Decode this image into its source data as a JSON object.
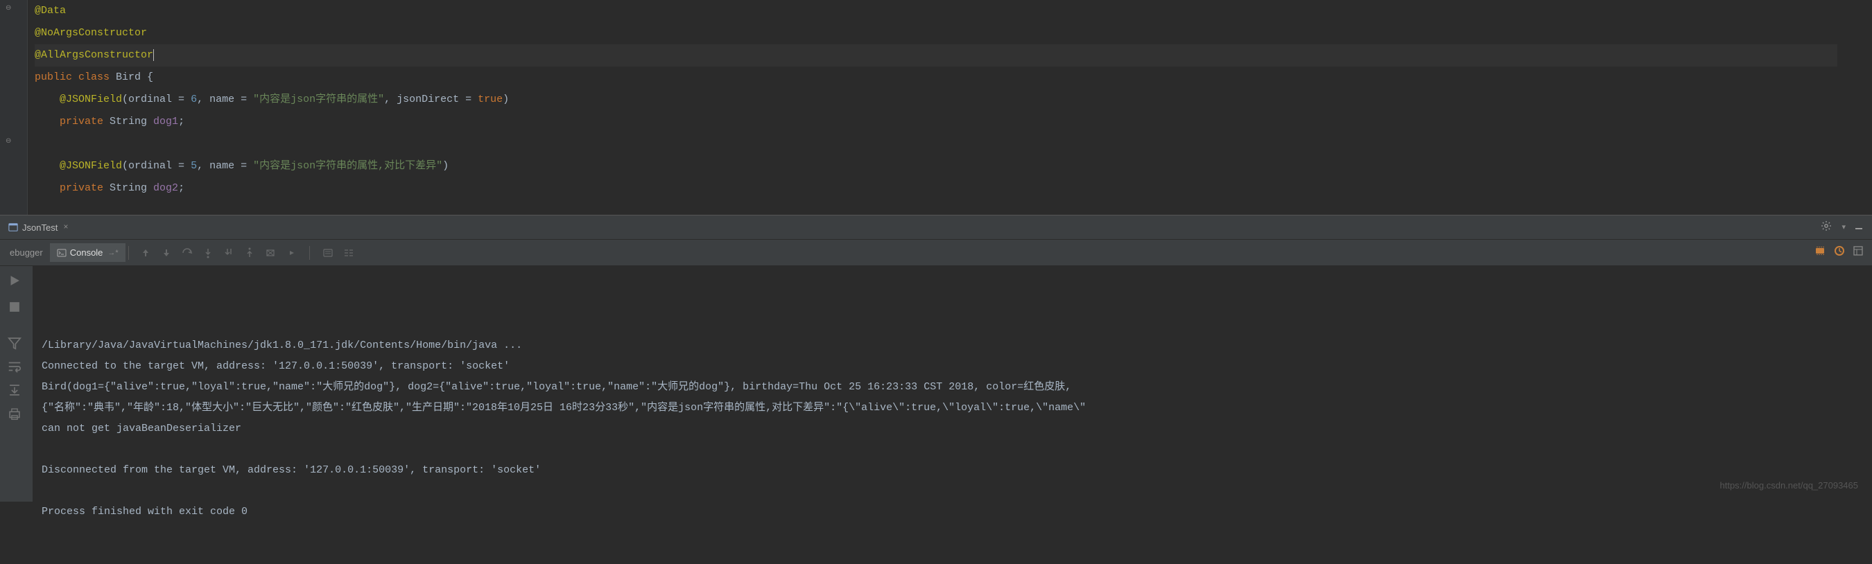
{
  "editor": {
    "lines": [
      {
        "segments": [
          {
            "cls": "anno",
            "t": "@Data"
          }
        ]
      },
      {
        "segments": [
          {
            "cls": "anno",
            "t": "@NoArgsConstructor"
          }
        ]
      },
      {
        "segments": [
          {
            "cls": "anno",
            "t": "@AllArgsConstructor"
          }
        ],
        "highlighted": true,
        "cursor": true
      },
      {
        "segments": [
          {
            "cls": "kw",
            "t": "public class "
          },
          {
            "cls": "ident",
            "t": "Bird {"
          }
        ]
      },
      {
        "segments": [
          {
            "cls": "ident",
            "t": "    "
          },
          {
            "cls": "anno",
            "t": "@JSONField"
          },
          {
            "cls": "paren",
            "t": "("
          },
          {
            "cls": "ident",
            "t": "ordinal = "
          },
          {
            "cls": "num",
            "t": "6"
          },
          {
            "cls": "ident",
            "t": ", name = "
          },
          {
            "cls": "str",
            "t": "\"内容是json字符串的属性\""
          },
          {
            "cls": "ident",
            "t": ", jsonDirect = "
          },
          {
            "cls": "kw",
            "t": "true"
          },
          {
            "cls": "paren",
            "t": ")"
          }
        ]
      },
      {
        "segments": [
          {
            "cls": "ident",
            "t": "    "
          },
          {
            "cls": "kw",
            "t": "private "
          },
          {
            "cls": "ident",
            "t": "String "
          },
          {
            "cls": "field",
            "t": "dog1"
          },
          {
            "cls": "ident",
            "t": ";"
          }
        ]
      },
      {
        "segments": []
      },
      {
        "segments": [
          {
            "cls": "ident",
            "t": "    "
          },
          {
            "cls": "anno",
            "t": "@JSONField"
          },
          {
            "cls": "paren",
            "t": "("
          },
          {
            "cls": "ident",
            "t": "ordinal = "
          },
          {
            "cls": "num",
            "t": "5"
          },
          {
            "cls": "ident",
            "t": ", name = "
          },
          {
            "cls": "str",
            "t": "\"内容是json字符串的属性,对比下差异\""
          },
          {
            "cls": "paren",
            "t": ")"
          }
        ]
      },
      {
        "segments": [
          {
            "cls": "ident",
            "t": "    "
          },
          {
            "cls": "kw",
            "t": "private "
          },
          {
            "cls": "ident",
            "t": "String "
          },
          {
            "cls": "field",
            "t": "dog2"
          },
          {
            "cls": "ident",
            "t": ";"
          }
        ]
      }
    ]
  },
  "tab": {
    "label": "JsonTest",
    "close_glyph": "×"
  },
  "debug_tabs": {
    "debugger": "ebugger",
    "console": "Console"
  },
  "console": {
    "lines": [
      "/Library/Java/JavaVirtualMachines/jdk1.8.0_171.jdk/Contents/Home/bin/java ...",
      "Connected to the target VM, address: '127.0.0.1:50039', transport: 'socket'",
      "Bird(dog1={\"alive\":true,\"loyal\":true,\"name\":\"大师兄的dog\"}, dog2={\"alive\":true,\"loyal\":true,\"name\":\"大师兄的dog\"}, birthday=Thu Oct 25 16:23:33 CST 2018, color=红色皮肤,",
      "{\"名称\":\"典韦\",\"年龄\":18,\"体型大小\":\"巨大无比\",\"颜色\":\"红色皮肤\",\"生产日期\":\"2018年10月25日 16时23分33秒\",\"内容是json字符串的属性,对比下差异\":\"{\\\"alive\\\":true,\\\"loyal\\\":true,\\\"name\\\"",
      "can not get javaBeanDeserializer",
      "",
      "Disconnected from the target VM, address: '127.0.0.1:50039', transport: 'socket'",
      "",
      "Process finished with exit code 0"
    ]
  },
  "watermark": "https://blog.csdn.net/qq_27093465"
}
